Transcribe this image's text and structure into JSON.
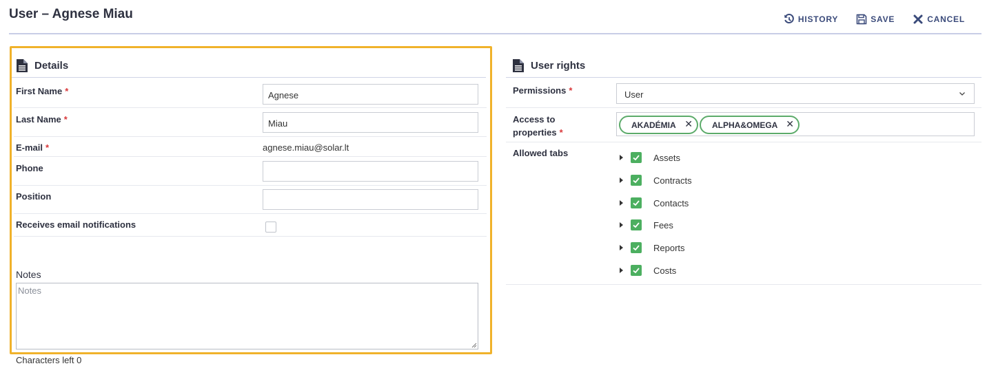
{
  "header": {
    "title": "User – Agnese Miau",
    "history_label": "HISTORY",
    "save_label": "SAVE",
    "cancel_label": "CANCEL",
    "accent_color": "#3a4a7a"
  },
  "details": {
    "heading": "Details",
    "highlight_color": "#f0b22a",
    "first_name_label": "First Name",
    "first_name_value": "Agnese",
    "last_name_label": "Last Name",
    "last_name_value": "Miau",
    "email_label": "E-mail",
    "email_value": "agnese.miau@solar.lt",
    "phone_label": "Phone",
    "phone_value": "",
    "position_label": "Position",
    "position_value": "",
    "notifications_label": "Receives email notifications",
    "notifications_checked": false,
    "notes_label": "Notes",
    "notes_placeholder": "Notes",
    "chars_left": "Characters left 0",
    "required_mark": "*"
  },
  "rights": {
    "heading": "User rights",
    "permissions_label": "Permissions",
    "permissions_value": "User",
    "access_label_line1": "Access to",
    "access_label_line2": "properties",
    "properties": [
      "AKADÉMIA",
      "ALPHA&OMEGA"
    ],
    "tag_color": "#5cab6a",
    "allowed_tabs_label": "Allowed tabs",
    "tabs": [
      "Assets",
      "Contracts",
      "Contacts",
      "Fees",
      "Reports",
      "Costs"
    ],
    "check_color": "#4caf60"
  }
}
